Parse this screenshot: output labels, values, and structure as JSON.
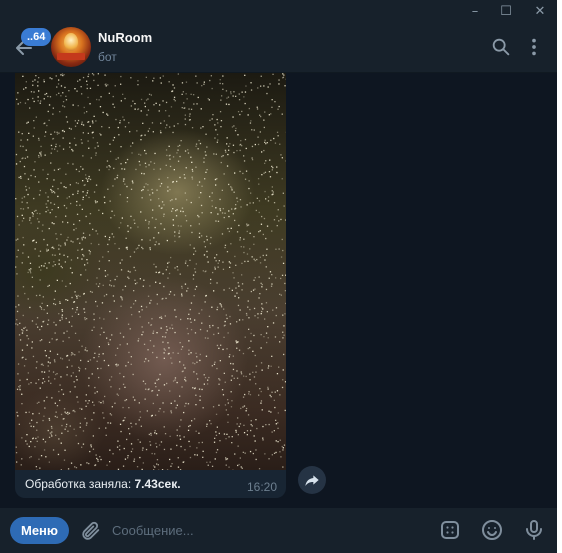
{
  "window": {
    "controls": {
      "minimize": "–",
      "maximize": "☐",
      "close": "✕"
    }
  },
  "header": {
    "unread_badge": "..64",
    "chat_name": "NuRoom",
    "chat_status": "бот",
    "icons": [
      "back-arrow-icon",
      "search-icon",
      "more-vertical-icon"
    ]
  },
  "message": {
    "caption_prefix": "Обработка заняла: ",
    "caption_value": "7.43сек.",
    "time": "16:20"
  },
  "composer": {
    "menu_label": "Меню",
    "input_placeholder": "Сообщение...",
    "icons": [
      "attach-icon",
      "bot-commands-icon",
      "emoji-icon",
      "microphone-icon"
    ]
  },
  "colors": {
    "window_bg": "#0e1621",
    "header_bg": "#17212b",
    "bubble_bg": "#182533",
    "accent": "#2e6bb5",
    "badge": "#3a7cd4"
  }
}
